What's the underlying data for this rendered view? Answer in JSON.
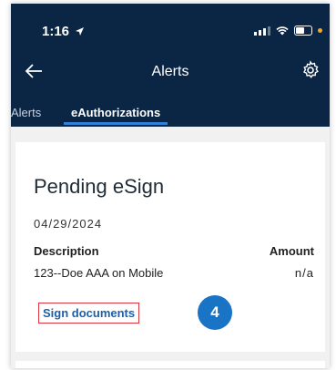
{
  "status_bar": {
    "time": "1:16"
  },
  "header": {
    "title": "Alerts"
  },
  "tabs": [
    {
      "label": "Alerts",
      "active": false
    },
    {
      "label": "eAuthorizations",
      "active": true
    }
  ],
  "card": {
    "title": "Pending eSign",
    "date": "04/29/2024",
    "columns": {
      "description": "Description",
      "amount": "Amount"
    },
    "row": {
      "description": "123--Doe AAA on Mobile",
      "amount": "n/a"
    },
    "action_label": "Sign documents"
  },
  "annotation": {
    "step_number": "4"
  },
  "colors": {
    "header_bg": "#0b2545",
    "tab_underline": "#2f80d6",
    "link": "#1d5fa8",
    "highlight_border": "#d9363e",
    "badge": "#1a74c6"
  }
}
